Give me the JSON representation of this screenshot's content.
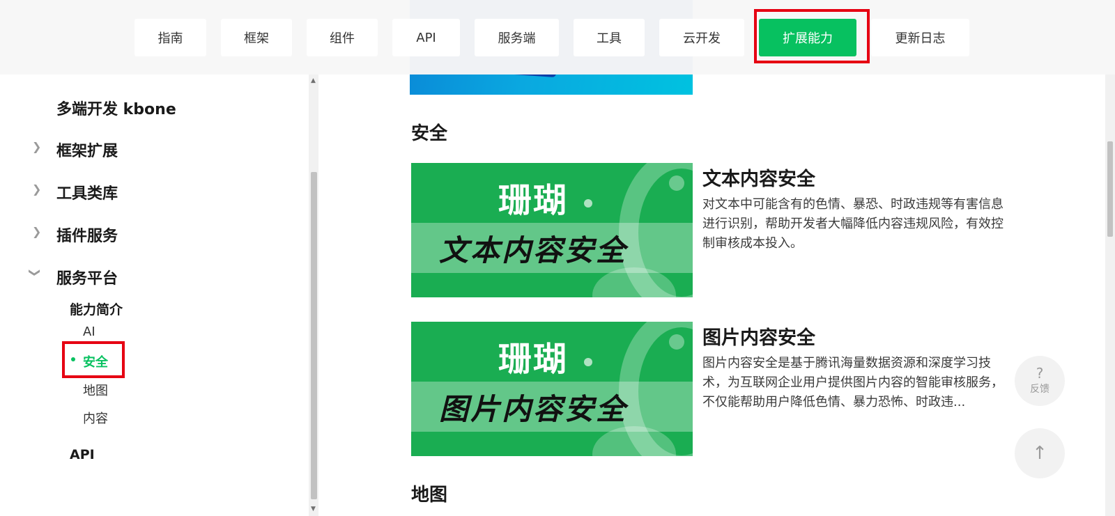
{
  "nav": {
    "items": [
      {
        "label": "指南"
      },
      {
        "label": "框架"
      },
      {
        "label": "组件"
      },
      {
        "label": "API"
      },
      {
        "label": "服务端"
      },
      {
        "label": "工具"
      },
      {
        "label": "云开发"
      },
      {
        "label": "扩展能力",
        "active": true
      },
      {
        "label": "更新日志"
      }
    ]
  },
  "sidebar": {
    "top_item": "多端开发 kbone",
    "groups": [
      {
        "label": "框架扩展",
        "expanded": false
      },
      {
        "label": "工具类库",
        "expanded": false
      },
      {
        "label": "插件服务",
        "expanded": false
      },
      {
        "label": "服务平台",
        "expanded": true
      }
    ],
    "sub_heading": "能力简介",
    "leaves": [
      "AI",
      "安全",
      "地图",
      "内容"
    ],
    "active_leaf": "安全",
    "api_heading": "API"
  },
  "content": {
    "section_security": "安全",
    "section_map": "地图",
    "cards": [
      {
        "brand": "珊瑚",
        "caption": "文本内容安全",
        "title": "文本内容安全",
        "desc": "对文本中可能含有的色情、暴恐、时政违规等有害信息进行识别，帮助开发者大幅降低内容违规风险，有效控制审核成本投入。"
      },
      {
        "brand": "珊瑚",
        "caption": "图片内容安全",
        "title": "图片内容安全",
        "desc": "图片内容安全是基于腾讯海量数据资源和深度学习技术，为互联网企业用户提供图片内容的智能审核服务，不仅能帮助用户降低色情、暴力恐怖、时政违..."
      }
    ]
  },
  "float": {
    "feedback_icon": "?",
    "feedback_label": "反馈",
    "top_icon": "↑"
  },
  "colors": {
    "accent": "#07c160",
    "highlight": "#e60012",
    "card_green": "#1aad52"
  }
}
